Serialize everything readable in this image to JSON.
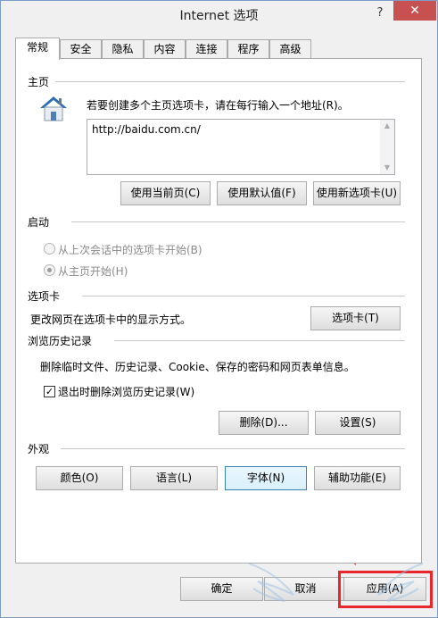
{
  "window": {
    "title": "Internet 选项",
    "help_glyph": "?",
    "close_glyph": "✕"
  },
  "tabs": [
    {
      "label": "常规",
      "active": true
    },
    {
      "label": "安全"
    },
    {
      "label": "隐私"
    },
    {
      "label": "内容"
    },
    {
      "label": "连接"
    },
    {
      "label": "程序"
    },
    {
      "label": "高级"
    }
  ],
  "home": {
    "section": "主页",
    "instruction": "若要创建多个主页选项卡，请在每行输入一个地址(R)。",
    "url": "http://baidu.com.cn/",
    "buttons": [
      "使用当前页(C)",
      "使用默认值(F)",
      "使用新选项卡(U)"
    ]
  },
  "startup": {
    "section": "启动",
    "options": [
      "从上次会话中的选项卡开始(B)",
      "从主页开始(H)"
    ],
    "selected": 1
  },
  "tabs_section": {
    "section": "选项卡",
    "description": "更改网页在选项卡中的显示方式。",
    "button": "选项卡(T)"
  },
  "history": {
    "section": "浏览历史记录",
    "description": "删除临时文件、历史记录、Cookie、保存的密码和网页表单信息。",
    "checkbox_label": "退出时删除浏览历史记录(W)",
    "checkbox_checked": true,
    "check_glyph": "✓",
    "delete_button": "删除(D)...",
    "settings_button": "设置(S)"
  },
  "appearance": {
    "section": "外观",
    "buttons": [
      "颜色(O)",
      "语言(L)",
      "字体(N)",
      "辅助功能(E)"
    ]
  },
  "footer": {
    "ok": "确定",
    "cancel": "取消",
    "apply": "应用(A)"
  },
  "annotation": {
    "highlight_color": "#e8262b"
  }
}
